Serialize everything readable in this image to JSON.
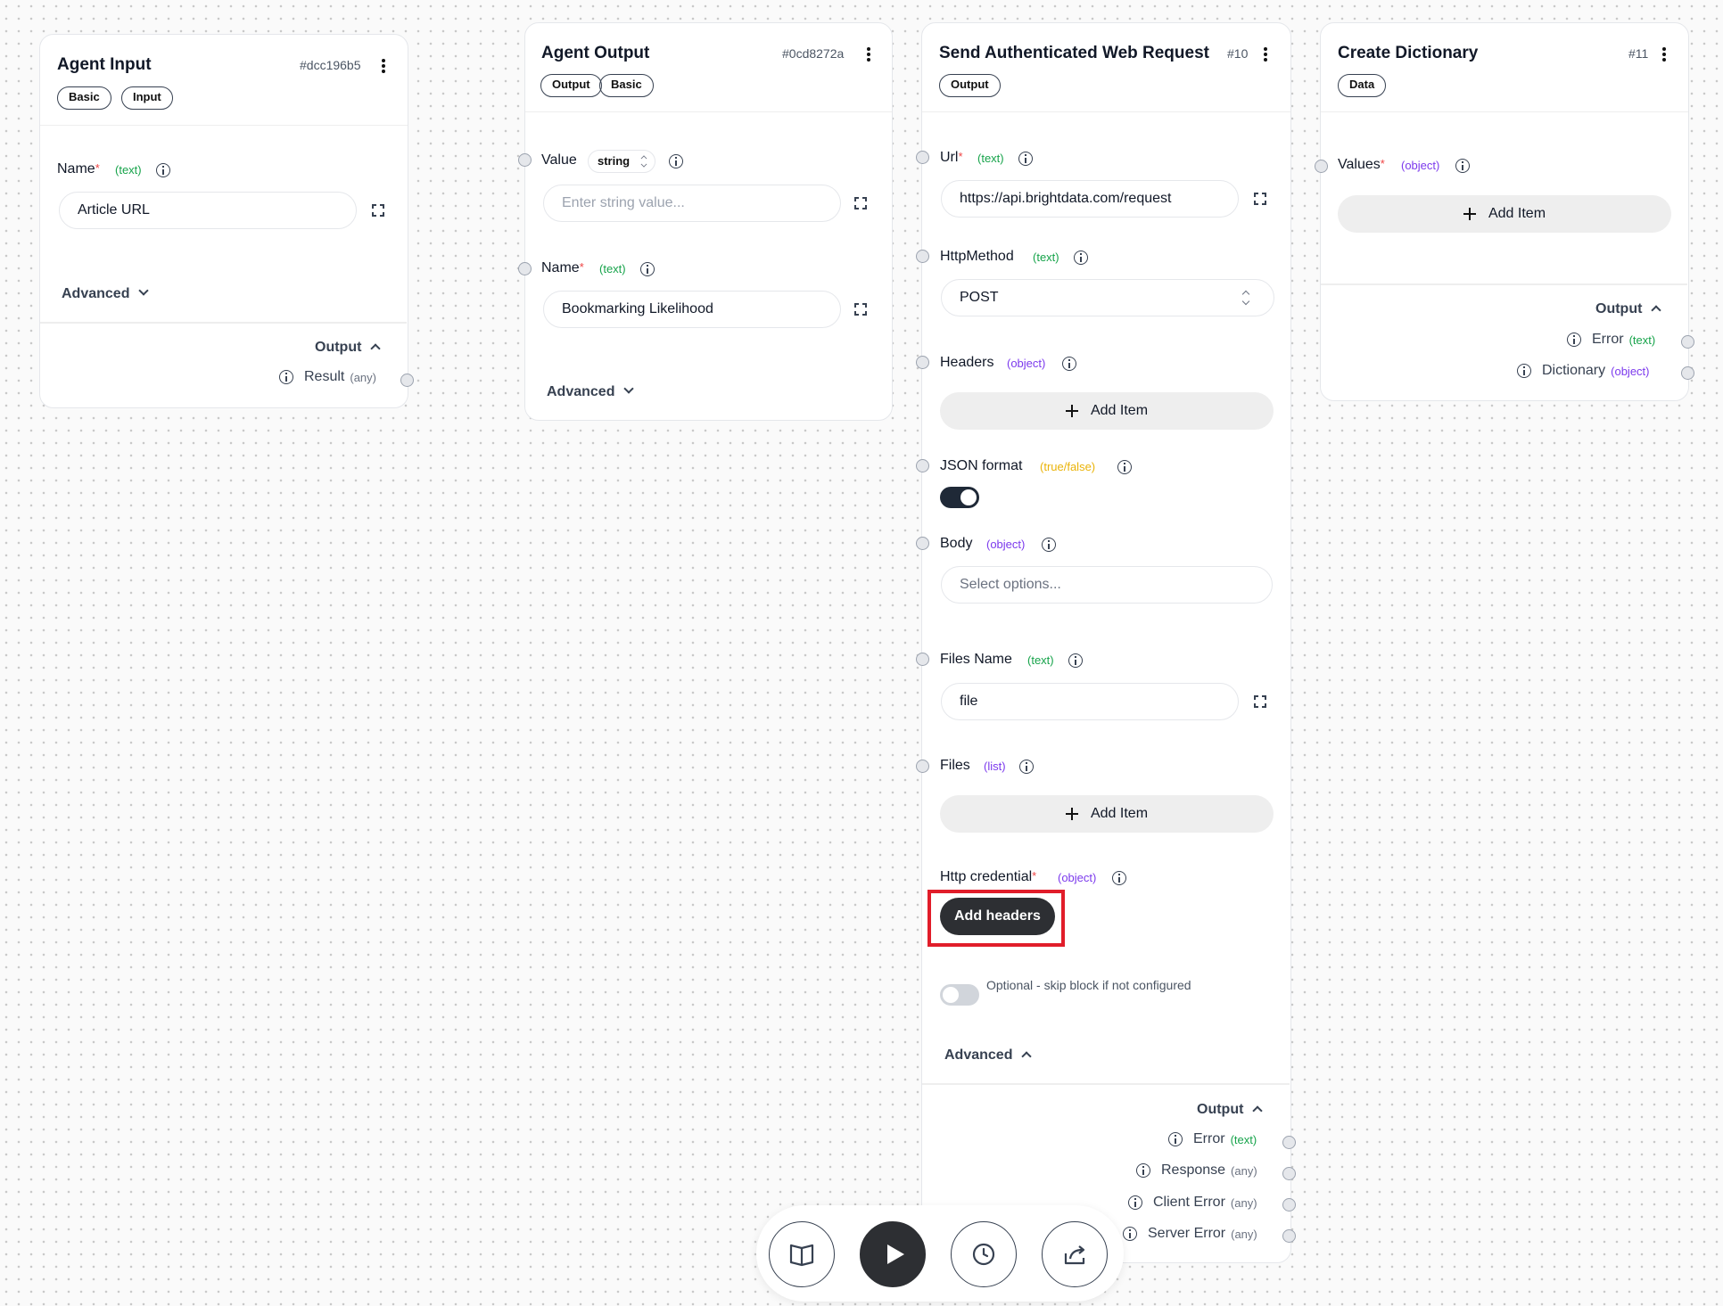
{
  "nodes": {
    "agent_input": {
      "title": "Agent Input",
      "id": "#dcc196b5",
      "tags": [
        "Basic",
        "Input"
      ],
      "name_label": "Name",
      "name_required": "*",
      "name_type": "(text)",
      "name_value": "Article URL",
      "advanced_label": "Advanced",
      "output_label": "Output",
      "outputs": [
        {
          "label": "Result",
          "type": "(any)"
        }
      ]
    },
    "agent_output": {
      "title": "Agent Output",
      "id": "#0cd8272a",
      "tags": [
        "Output",
        "Basic"
      ],
      "value_label": "Value",
      "value_type_select": "string",
      "value_placeholder": "Enter string value...",
      "name_label": "Name",
      "name_required": "*",
      "name_type": "(text)",
      "name_value": "Bookmarking Likelihood",
      "advanced_label": "Advanced"
    },
    "web_request": {
      "title": "Send Authenticated Web Request",
      "id": "#10",
      "tags": [
        "Output"
      ],
      "url_label": "Url",
      "url_required": "*",
      "url_type": "(text)",
      "url_value": "https://api.brightdata.com/request",
      "method_label": "HttpMethod",
      "method_type": "(text)",
      "method_value": "POST",
      "headers_label": "Headers",
      "headers_type": "(object)",
      "add_item_label": "Add Item",
      "json_label": "JSON format",
      "json_type": "(true/false)",
      "json_on": true,
      "body_label": "Body",
      "body_type": "(object)",
      "body_placeholder": "Select options...",
      "files_name_label": "Files Name",
      "files_name_type": "(text)",
      "files_name_value": "file",
      "files_label": "Files",
      "files_type": "(list)",
      "credential_label": "Http credential",
      "credential_required": "*",
      "credential_type": "(object)",
      "add_headers_label": "Add headers",
      "optional_label": "Optional - skip block if not configured",
      "optional_on": false,
      "advanced_label": "Advanced",
      "output_label": "Output",
      "outputs": [
        {
          "label": "Error",
          "type": "(text)"
        },
        {
          "label": "Response",
          "type": "(any)"
        },
        {
          "label": "Client Error",
          "type": "(any)"
        },
        {
          "label": "Server Error",
          "type": "(any)"
        }
      ]
    },
    "create_dictionary": {
      "title": "Create Dictionary",
      "id": "#11",
      "tags": [
        "Data"
      ],
      "values_label": "Values",
      "values_required": "*",
      "values_type": "(object)",
      "add_item_label": "Add Item",
      "output_label": "Output",
      "outputs": [
        {
          "label": "Error",
          "type": "(text)"
        },
        {
          "label": "Dictionary",
          "type": "(object)"
        }
      ]
    }
  },
  "toolbar": {
    "buttons": [
      "book-icon",
      "play-icon",
      "history-icon",
      "share-icon"
    ]
  },
  "colors": {
    "type_text": "#16a34a",
    "type_object": "#7c3aed",
    "type_bool": "#eab308",
    "highlight": "#e11d2a",
    "dark_button": "#2d2f33"
  }
}
